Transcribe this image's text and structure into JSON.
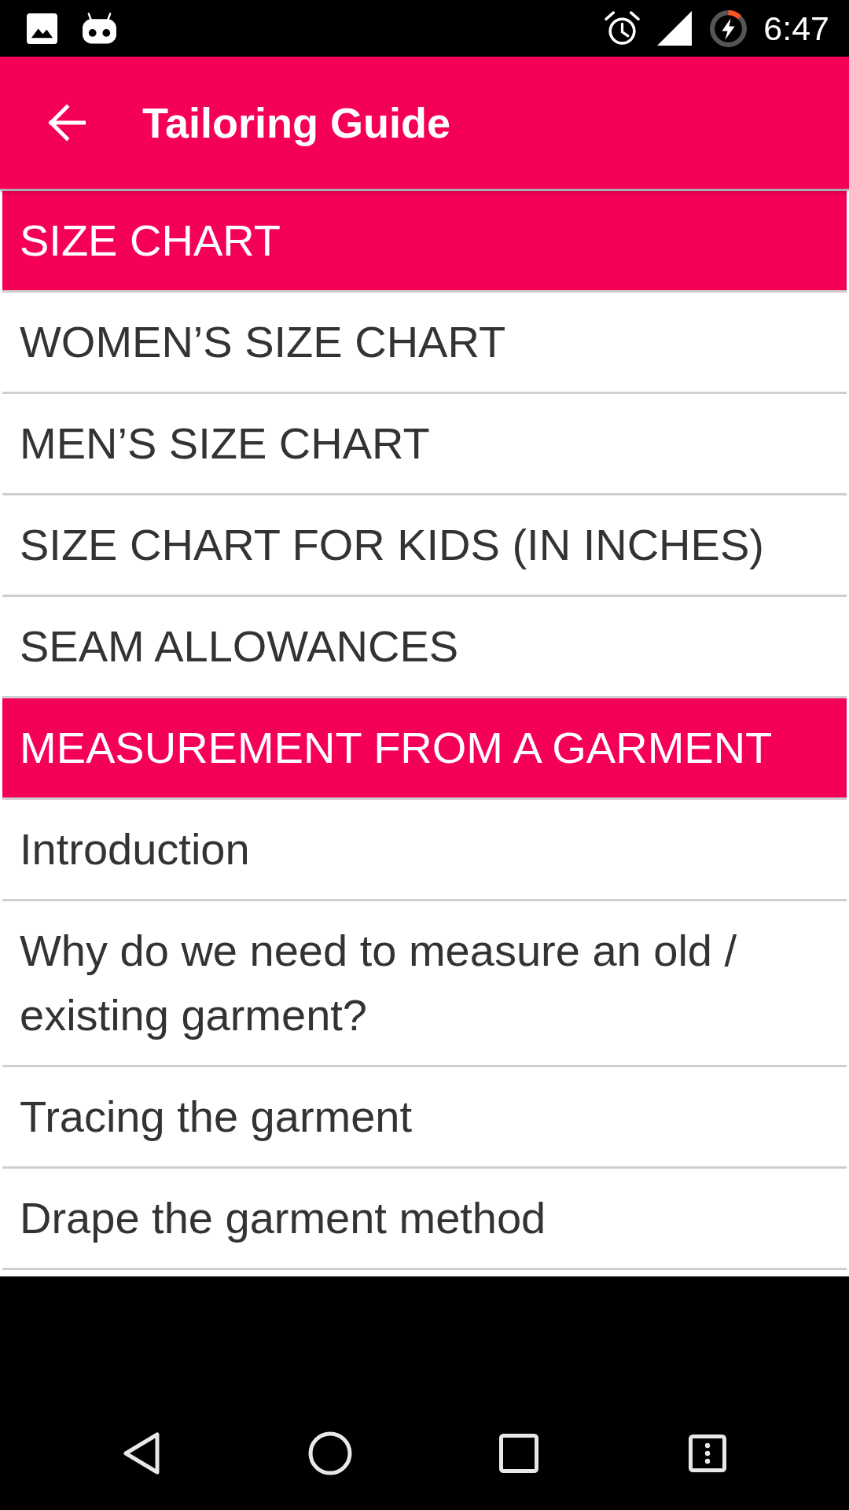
{
  "status_bar": {
    "time": "6:47"
  },
  "app_bar": {
    "title": "Tailoring Guide"
  },
  "list": {
    "items": [
      {
        "kind": "header",
        "label": "SIZE CHART"
      },
      {
        "kind": "item",
        "label": "WOMEN’S SIZE CHART"
      },
      {
        "kind": "item",
        "label": "MEN’S SIZE CHART"
      },
      {
        "kind": "item",
        "label": "SIZE CHART FOR KIDS (IN INCHES)"
      },
      {
        "kind": "item",
        "label": "SEAM ALLOWANCES"
      },
      {
        "kind": "header",
        "label": "MEASUREMENT FROM A GARMENT"
      },
      {
        "kind": "item",
        "label": "Introduction"
      },
      {
        "kind": "item",
        "label": "Why do we need to measure an old / existing garment?"
      },
      {
        "kind": "item",
        "label": "Tracing the garment"
      },
      {
        "kind": "item",
        "label": "Drape the garment method"
      }
    ]
  }
}
